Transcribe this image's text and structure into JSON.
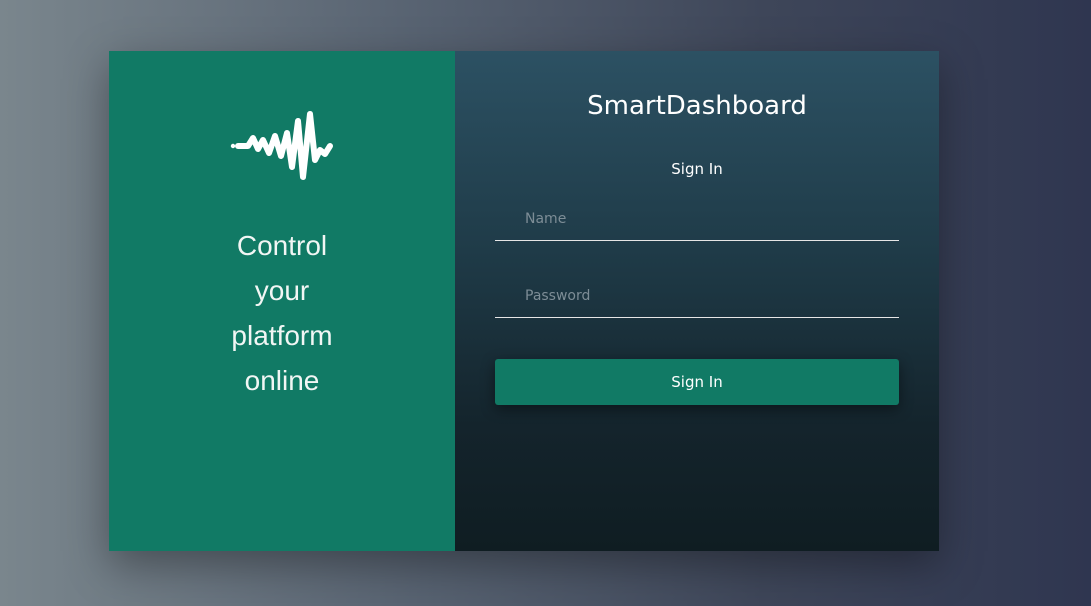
{
  "brand": {
    "tagline": "Control\nyour\nplatform\nonline",
    "logo_icon": "waveform-icon"
  },
  "login": {
    "app_title": "SmartDashboard",
    "heading": "Sign In",
    "name_placeholder": "Name",
    "password_placeholder": "Password",
    "submit_label": "Sign In"
  },
  "colors": {
    "brand_green": "#117a65",
    "panel_dark": "#1f3b48"
  }
}
